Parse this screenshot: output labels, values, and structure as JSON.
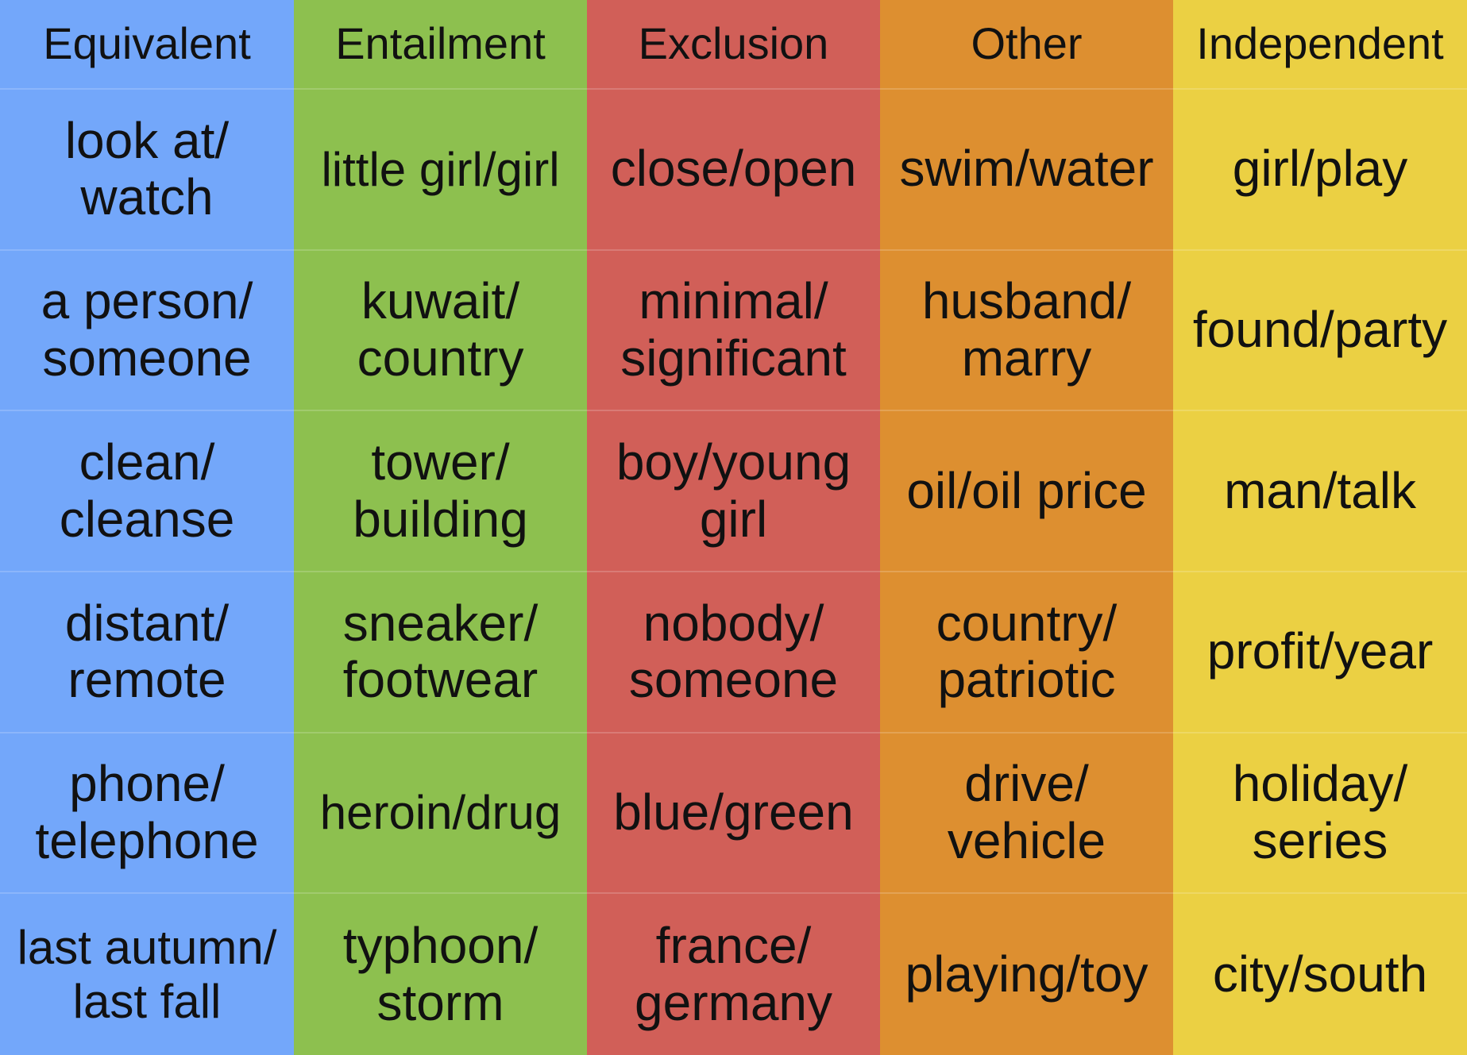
{
  "table": {
    "columns": [
      {
        "header": "Equivalent",
        "color": "#73a7fa",
        "cells": [
          "look at/\nwatch",
          "a person/\nsomeone",
          "clean/\ncleanse",
          "distant/\nremote",
          "phone/\ntelephone",
          "last autumn/\nlast fall"
        ]
      },
      {
        "header": "Entailment",
        "color": "#8dc04f",
        "cells": [
          "little girl/girl",
          "kuwait/\ncountry",
          "tower/\nbuilding",
          "sneaker/\nfootwear",
          "heroin/drug",
          "typhoon/\nstorm"
        ]
      },
      {
        "header": "Exclusion",
        "color": "#d15f58",
        "cells": [
          "close/open",
          "minimal/\nsignificant",
          "boy/young\ngirl",
          "nobody/\nsomeone",
          "blue/green",
          "france/\ngermany"
        ]
      },
      {
        "header": "Other",
        "color": "#dd8f30",
        "cells": [
          "swim/water",
          "husband/\nmarry",
          "oil/oil price",
          "country/\npatriotic",
          "drive/\nvehicle",
          "playing/toy"
        ]
      },
      {
        "header": "Independent",
        "color": "#ebd043",
        "cells": [
          "girl/play",
          "found/party",
          "man/talk",
          "profit/year",
          "holiday/\nseries",
          "city/south"
        ]
      }
    ]
  }
}
